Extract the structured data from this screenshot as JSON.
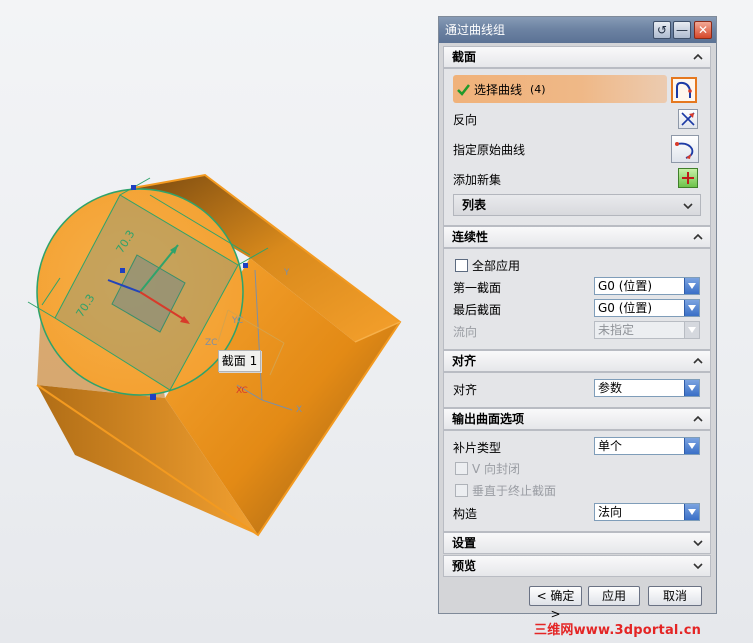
{
  "viewport": {
    "section_tag": "截面 1",
    "axis_x": "X",
    "axis_y": "Y",
    "axis_zc": "ZC",
    "axis_yc": "YC",
    "axis_xc": "XC",
    "dim_1": "70.3",
    "dim_2": "70.3"
  },
  "dialog": {
    "title": "通过曲线组",
    "sections": {
      "section": {
        "title": "截面",
        "select_curve": "选择曲线",
        "select_count": "(4)",
        "reverse": "反向",
        "specify_origin": "指定原始曲线",
        "add_new_set": "添加新集",
        "list": "列表"
      },
      "continuity": {
        "title": "连续性",
        "apply_all": "全部应用",
        "first_section": "第一截面",
        "first_value": "G0 (位置)",
        "last_section": "最后截面",
        "last_value": "G0 (位置)",
        "flow_dir": "流向",
        "flow_value": "未指定"
      },
      "alignment": {
        "title": "对齐",
        "label": "对齐",
        "value": "参数"
      },
      "output": {
        "title": "输出曲面选项",
        "patch_type": "补片类型",
        "patch_value": "单个",
        "v_closed": "V 向封闭",
        "normal_end": "垂直于终止截面",
        "construct": "构造",
        "construct_value": "法向"
      },
      "settings": {
        "title": "设置"
      },
      "preview": {
        "title": "预览"
      }
    },
    "buttons": {
      "ok": "< 确定 >",
      "apply": "应用",
      "cancel": "取消"
    }
  },
  "watermark": "三维网www.3dportal.cn",
  "colors": {
    "accent_orange": "#f5a02c",
    "title_blue": "#6d83a3",
    "watermark_red": "#e42525"
  }
}
